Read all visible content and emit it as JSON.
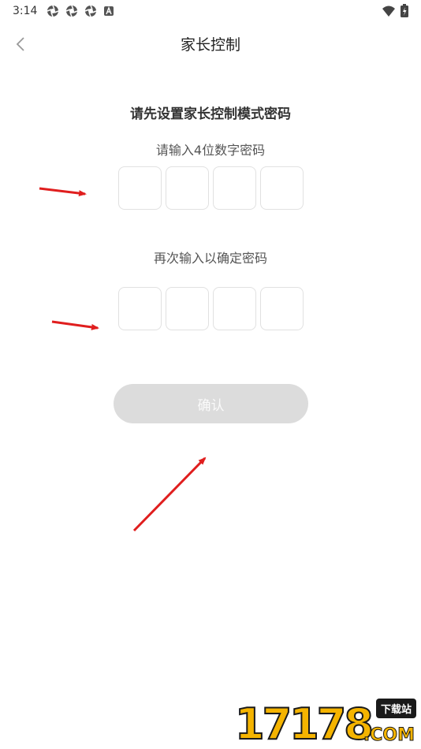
{
  "status_bar": {
    "time": "3:14",
    "notification_icons": [
      "aperture-icon",
      "aperture-icon",
      "aperture-icon",
      "a-badge-icon"
    ],
    "right_icons": [
      "wifi-icon",
      "battery-charging-icon"
    ]
  },
  "header": {
    "title": "家长控制",
    "back_icon": "chevron-left-icon"
  },
  "form": {
    "heading": "请先设置家长控制模式密码",
    "first_prompt": "请输入4位数字密码",
    "first_pin": [
      "",
      "",
      "",
      ""
    ],
    "second_prompt": "再次输入以确定密码",
    "second_pin": [
      "",
      "",
      "",
      ""
    ],
    "confirm_label": "确认",
    "confirm_enabled": false
  },
  "watermark": {
    "digits": "17178",
    "badge": "下载站",
    "domain": ".COM"
  },
  "colors": {
    "annotation_arrow": "#e01e1e",
    "button_disabled": "#dcdcdc",
    "pin_border": "#e1e1e1",
    "watermark_accent": "#f5b400"
  }
}
